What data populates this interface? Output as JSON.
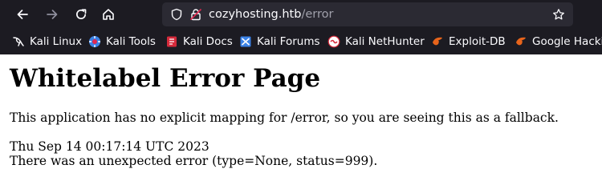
{
  "browser": {
    "url_host": "cozyhosting.htb",
    "url_path": "/error",
    "icons": [
      "back-arrow-icon",
      "forward-arrow-icon",
      "reload-icon",
      "home-icon",
      "shield-icon",
      "insecure-lock-icon",
      "star-icon"
    ]
  },
  "bookmarks": [
    {
      "label": "Kali Linux",
      "icon": "kali-dragon-icon"
    },
    {
      "label": "Kali Tools",
      "icon": "kali-tools-icon"
    },
    {
      "label": "Kali Docs",
      "icon": "kali-docs-icon"
    },
    {
      "label": "Kali Forums",
      "icon": "kali-forums-icon"
    },
    {
      "label": "Kali NetHunter",
      "icon": "nethunter-icon"
    },
    {
      "label": "Exploit-DB",
      "icon": "exploit-db-icon"
    },
    {
      "label": "Google Hackin",
      "icon": "ghdb-icon"
    }
  ],
  "page": {
    "heading": "Whitelabel Error Page",
    "message": "This application has no explicit mapping for /error, so you are seeing this as a fallback.",
    "timestamp": "Thu Sep 14 00:17:14 UTC 2023",
    "error_detail": "There was an unexpected error (type=None, status=999)."
  },
  "colors": {
    "chrome_bg": "#1c1b22",
    "urlbar_bg": "#2b2a33",
    "page_bg": "#ffffff",
    "exploit_orange": "#e8641b"
  }
}
